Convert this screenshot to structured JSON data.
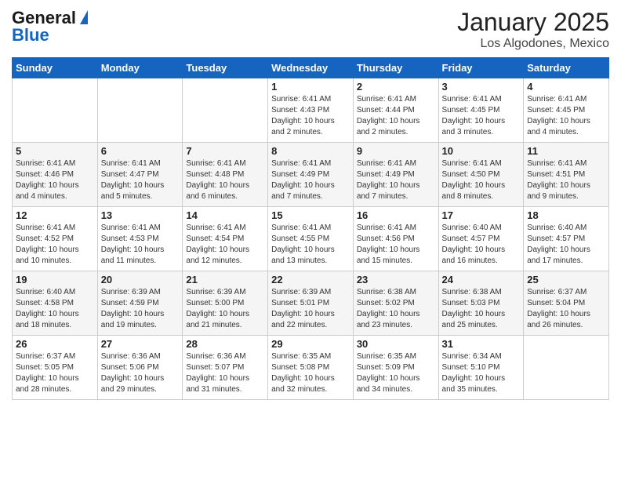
{
  "header": {
    "logo_line1": "General",
    "logo_line2": "Blue",
    "title": "January 2025",
    "subtitle": "Los Algodones, Mexico"
  },
  "days_of_week": [
    "Sunday",
    "Monday",
    "Tuesday",
    "Wednesday",
    "Thursday",
    "Friday",
    "Saturday"
  ],
  "weeks": [
    [
      {
        "day": "",
        "info": ""
      },
      {
        "day": "",
        "info": ""
      },
      {
        "day": "",
        "info": ""
      },
      {
        "day": "1",
        "info": "Sunrise: 6:41 AM\nSunset: 4:43 PM\nDaylight: 10 hours\nand 2 minutes."
      },
      {
        "day": "2",
        "info": "Sunrise: 6:41 AM\nSunset: 4:44 PM\nDaylight: 10 hours\nand 2 minutes."
      },
      {
        "day": "3",
        "info": "Sunrise: 6:41 AM\nSunset: 4:45 PM\nDaylight: 10 hours\nand 3 minutes."
      },
      {
        "day": "4",
        "info": "Sunrise: 6:41 AM\nSunset: 4:45 PM\nDaylight: 10 hours\nand 4 minutes."
      }
    ],
    [
      {
        "day": "5",
        "info": "Sunrise: 6:41 AM\nSunset: 4:46 PM\nDaylight: 10 hours\nand 4 minutes."
      },
      {
        "day": "6",
        "info": "Sunrise: 6:41 AM\nSunset: 4:47 PM\nDaylight: 10 hours\nand 5 minutes."
      },
      {
        "day": "7",
        "info": "Sunrise: 6:41 AM\nSunset: 4:48 PM\nDaylight: 10 hours\nand 6 minutes."
      },
      {
        "day": "8",
        "info": "Sunrise: 6:41 AM\nSunset: 4:49 PM\nDaylight: 10 hours\nand 7 minutes."
      },
      {
        "day": "9",
        "info": "Sunrise: 6:41 AM\nSunset: 4:49 PM\nDaylight: 10 hours\nand 7 minutes."
      },
      {
        "day": "10",
        "info": "Sunrise: 6:41 AM\nSunset: 4:50 PM\nDaylight: 10 hours\nand 8 minutes."
      },
      {
        "day": "11",
        "info": "Sunrise: 6:41 AM\nSunset: 4:51 PM\nDaylight: 10 hours\nand 9 minutes."
      }
    ],
    [
      {
        "day": "12",
        "info": "Sunrise: 6:41 AM\nSunset: 4:52 PM\nDaylight: 10 hours\nand 10 minutes."
      },
      {
        "day": "13",
        "info": "Sunrise: 6:41 AM\nSunset: 4:53 PM\nDaylight: 10 hours\nand 11 minutes."
      },
      {
        "day": "14",
        "info": "Sunrise: 6:41 AM\nSunset: 4:54 PM\nDaylight: 10 hours\nand 12 minutes."
      },
      {
        "day": "15",
        "info": "Sunrise: 6:41 AM\nSunset: 4:55 PM\nDaylight: 10 hours\nand 13 minutes."
      },
      {
        "day": "16",
        "info": "Sunrise: 6:41 AM\nSunset: 4:56 PM\nDaylight: 10 hours\nand 15 minutes."
      },
      {
        "day": "17",
        "info": "Sunrise: 6:40 AM\nSunset: 4:57 PM\nDaylight: 10 hours\nand 16 minutes."
      },
      {
        "day": "18",
        "info": "Sunrise: 6:40 AM\nSunset: 4:57 PM\nDaylight: 10 hours\nand 17 minutes."
      }
    ],
    [
      {
        "day": "19",
        "info": "Sunrise: 6:40 AM\nSunset: 4:58 PM\nDaylight: 10 hours\nand 18 minutes."
      },
      {
        "day": "20",
        "info": "Sunrise: 6:39 AM\nSunset: 4:59 PM\nDaylight: 10 hours\nand 19 minutes."
      },
      {
        "day": "21",
        "info": "Sunrise: 6:39 AM\nSunset: 5:00 PM\nDaylight: 10 hours\nand 21 minutes."
      },
      {
        "day": "22",
        "info": "Sunrise: 6:39 AM\nSunset: 5:01 PM\nDaylight: 10 hours\nand 22 minutes."
      },
      {
        "day": "23",
        "info": "Sunrise: 6:38 AM\nSunset: 5:02 PM\nDaylight: 10 hours\nand 23 minutes."
      },
      {
        "day": "24",
        "info": "Sunrise: 6:38 AM\nSunset: 5:03 PM\nDaylight: 10 hours\nand 25 minutes."
      },
      {
        "day": "25",
        "info": "Sunrise: 6:37 AM\nSunset: 5:04 PM\nDaylight: 10 hours\nand 26 minutes."
      }
    ],
    [
      {
        "day": "26",
        "info": "Sunrise: 6:37 AM\nSunset: 5:05 PM\nDaylight: 10 hours\nand 28 minutes."
      },
      {
        "day": "27",
        "info": "Sunrise: 6:36 AM\nSunset: 5:06 PM\nDaylight: 10 hours\nand 29 minutes."
      },
      {
        "day": "28",
        "info": "Sunrise: 6:36 AM\nSunset: 5:07 PM\nDaylight: 10 hours\nand 31 minutes."
      },
      {
        "day": "29",
        "info": "Sunrise: 6:35 AM\nSunset: 5:08 PM\nDaylight: 10 hours\nand 32 minutes."
      },
      {
        "day": "30",
        "info": "Sunrise: 6:35 AM\nSunset: 5:09 PM\nDaylight: 10 hours\nand 34 minutes."
      },
      {
        "day": "31",
        "info": "Sunrise: 6:34 AM\nSunset: 5:10 PM\nDaylight: 10 hours\nand 35 minutes."
      },
      {
        "day": "",
        "info": ""
      }
    ]
  ]
}
